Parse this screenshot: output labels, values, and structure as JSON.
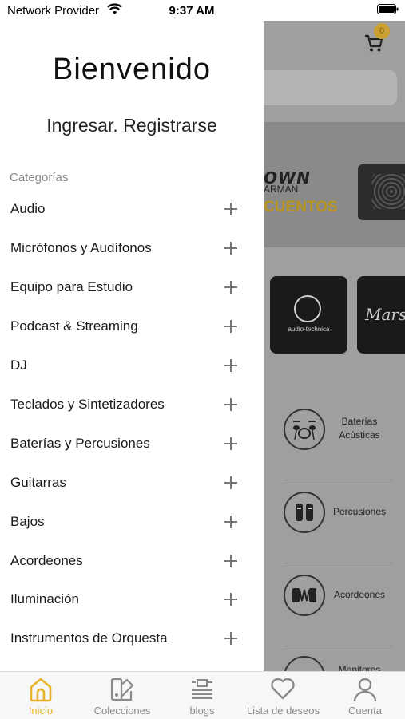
{
  "status_bar": {
    "carrier": "Network Provider",
    "time": "9:37 AM"
  },
  "drawer": {
    "welcome": "Bienvenido",
    "login_links": "Ingresar. Registrarse",
    "categories_header": "Categorías",
    "items": [
      {
        "label": "Audio"
      },
      {
        "label": "Micrófonos y Audífonos"
      },
      {
        "label": "Equipo para Estudio"
      },
      {
        "label": "Podcast & Streaming"
      },
      {
        "label": "DJ"
      },
      {
        "label": "Teclados y Sintetizadores"
      },
      {
        "label": "Baterías y Percusiones"
      },
      {
        "label": "Guitarras"
      },
      {
        "label": "Bajos"
      },
      {
        "label": "Acordeones"
      },
      {
        "label": "Iluminación"
      },
      {
        "label": "Instrumentos de Orquesta"
      }
    ]
  },
  "background": {
    "cart_count": "0",
    "banner": {
      "brand": "OWN",
      "sub": "ARMAN",
      "promo": "CUENTOS"
    },
    "brands": [
      {
        "name": "audio-technica"
      },
      {
        "name": "Marsh"
      }
    ],
    "categories": [
      {
        "name": "Baterías Acústicas"
      },
      {
        "name": "Percusiones"
      },
      {
        "name": "Acordeones"
      },
      {
        "name": "Monitores"
      }
    ]
  },
  "tab_bar": {
    "active_color": "#e5b42a",
    "tabs": [
      {
        "label": "Inicio",
        "icon": "home-icon"
      },
      {
        "label": "Colecciones",
        "icon": "collections-icon"
      },
      {
        "label": "blogs",
        "icon": "blogs-icon"
      },
      {
        "label": "Lista de deseos",
        "icon": "heart-icon"
      },
      {
        "label": "Cuenta",
        "icon": "account-icon"
      }
    ]
  }
}
